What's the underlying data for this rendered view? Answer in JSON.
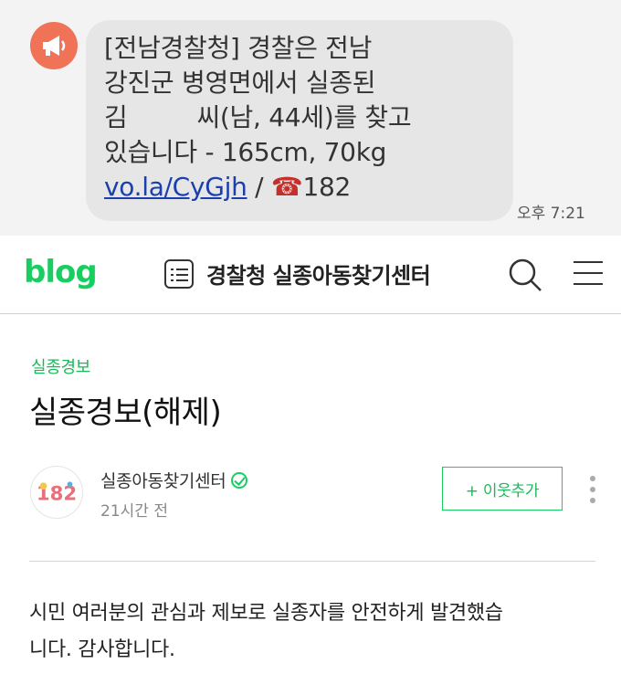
{
  "sms": {
    "line1": "[전남경찰청] 경찰은 전남",
    "line2": "강진군 병영면에서 실종된",
    "line3_a": "김",
    "line3_b": "씨(남, 44세)를 찾고",
    "line4": "있습니다 - 165cm, 70kg",
    "link": "vo.la/CyGjh",
    "separator": " / ",
    "phone_glyph": "☎",
    "phone_number": "182",
    "time": "오후 7:21",
    "avatar_icon": "megaphone-icon",
    "avatar_color": "#f07358"
  },
  "header": {
    "logo": "blog",
    "title": "경찰청 실종아동찾기센터",
    "brand_color": "#19ce60"
  },
  "post": {
    "category": "실종경보",
    "title": "실종경보(해제)",
    "author_name": "실종아동찾기센터",
    "author_time": "21시간 전",
    "avatar_text": "182",
    "follow_label": "+ 이웃추가",
    "body_line1": "시민 여러분의 관심과 제보로 실종자를 안전하게 발견했습",
    "body_line2": "니다. 감사합니다."
  }
}
